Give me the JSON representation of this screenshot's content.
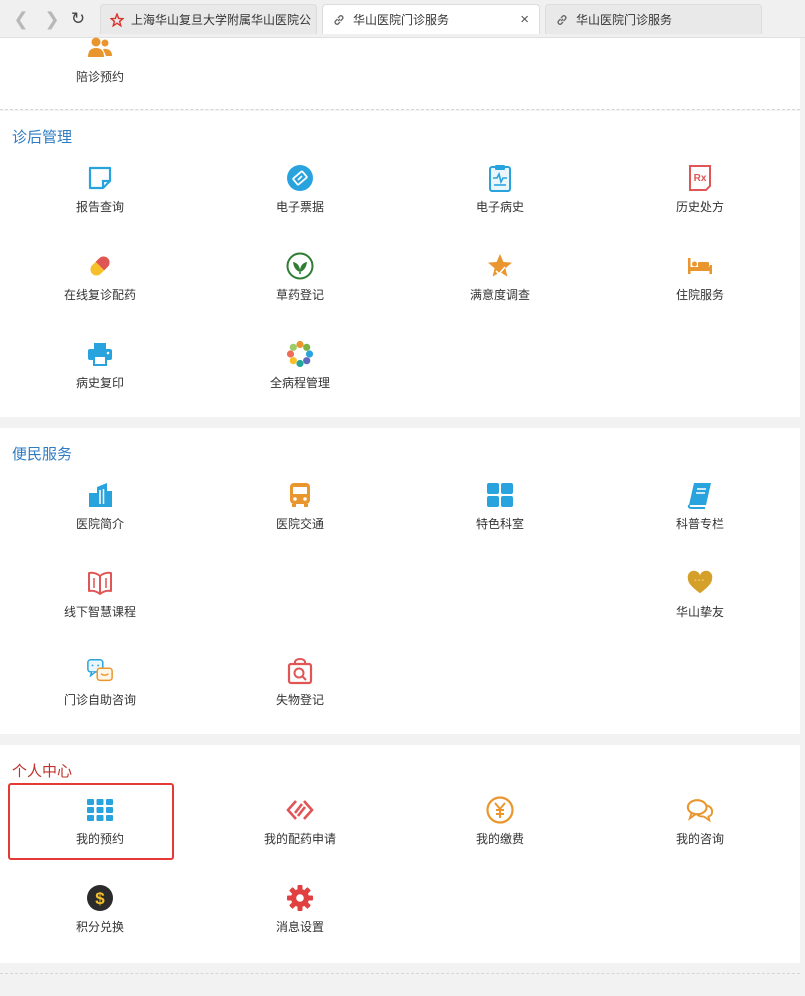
{
  "browser": {
    "tabs": [
      {
        "title": "上海华山复旦大学附属华山医院公",
        "icon": "star-logo-icon"
      },
      {
        "title": "华山医院门诊服务",
        "icon": "link-icon",
        "close": "×"
      },
      {
        "title": "华山医院门诊服务",
        "icon": "link-icon"
      }
    ]
  },
  "top": {
    "items": [
      {
        "label": "陪诊预约",
        "icon": "escort-user-icon"
      }
    ]
  },
  "post_care": {
    "title": "诊后管理",
    "items": [
      {
        "label": "报告查询",
        "icon": "report-icon"
      },
      {
        "label": "电子票据",
        "icon": "e-ticket-icon"
      },
      {
        "label": "电子病史",
        "icon": "medical-record-icon"
      },
      {
        "label": "历史处方",
        "icon": "prescription-rx-icon"
      },
      {
        "label": "在线复诊配药",
        "icon": "pill-capsule-icon"
      },
      {
        "label": "草药登记",
        "icon": "herb-leaf-icon"
      },
      {
        "label": "满意度调查",
        "icon": "satisfaction-star-icon"
      },
      {
        "label": "住院服务",
        "icon": "hospital-bed-icon"
      },
      {
        "label": "病史复印",
        "icon": "printer-icon"
      },
      {
        "label": "全病程管理",
        "icon": "full-course-wheel-icon"
      }
    ]
  },
  "convenience": {
    "title": "便民服务",
    "items": [
      {
        "label": "医院简介",
        "icon": "hospital-building-icon"
      },
      {
        "label": "医院交通",
        "icon": "bus-icon"
      },
      {
        "label": "特色科室",
        "icon": "grid-squares-icon"
      },
      {
        "label": "科普专栏",
        "icon": "book-icon"
      },
      {
        "label": "线下智慧课程",
        "icon": "open-book-icon"
      },
      {
        "label": "华山挚友",
        "icon": "heart-icon"
      },
      {
        "label": "门诊自助咨询",
        "icon": "chat-bubbles-icon"
      },
      {
        "label": "失物登记",
        "icon": "lost-found-bag-icon"
      }
    ]
  },
  "personal": {
    "title": "个人中心",
    "items": [
      {
        "label": "我的预约",
        "icon": "apps-grid-icon"
      },
      {
        "label": "我的配药申请",
        "icon": "medicine-link-icon"
      },
      {
        "label": "我的缴费",
        "icon": "yuan-coin-icon"
      },
      {
        "label": "我的咨询",
        "icon": "consult-chat-icon"
      },
      {
        "label": "积分兑换",
        "icon": "dollar-coin-icon"
      },
      {
        "label": "消息设置",
        "icon": "gear-icon"
      }
    ]
  },
  "colors": {
    "section_title_blue": "#2f7cc2",
    "section_title_red": "#c0312b",
    "highlight_border": "#e53935",
    "icon_blue": "#29a3dd",
    "icon_orange": "#e9962e",
    "icon_red": "#e05555"
  }
}
